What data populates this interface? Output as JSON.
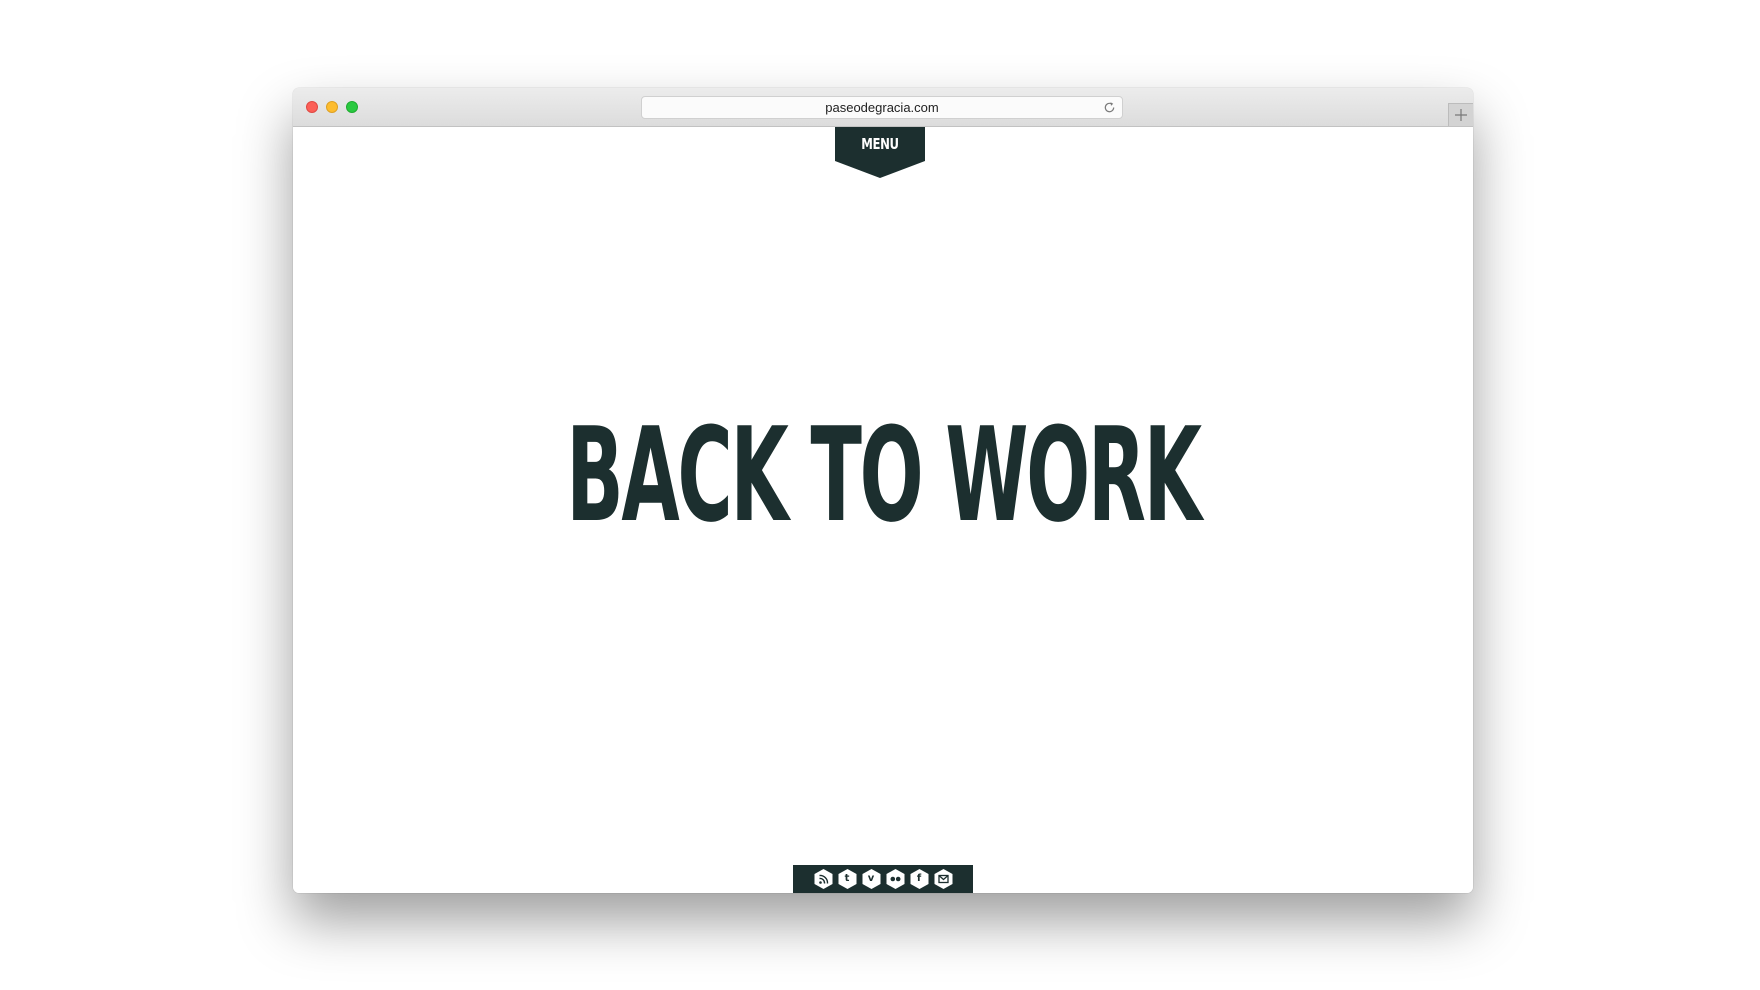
{
  "browser": {
    "url": "paseodegracia.com"
  },
  "page": {
    "menu_label": "MENU",
    "hero_title": "BACK TO WORK"
  },
  "social": {
    "icons": [
      {
        "name": "rss-icon",
        "glyph": ""
      },
      {
        "name": "tumblr-icon",
        "glyph": "t"
      },
      {
        "name": "vimeo-icon",
        "glyph": "v"
      },
      {
        "name": "flickr-icon",
        "glyph": ""
      },
      {
        "name": "facebook-icon",
        "glyph": "f"
      },
      {
        "name": "email-icon",
        "glyph": ""
      }
    ]
  },
  "colors": {
    "brand_dark": "#1c2f2f",
    "background": "#ffffff"
  }
}
